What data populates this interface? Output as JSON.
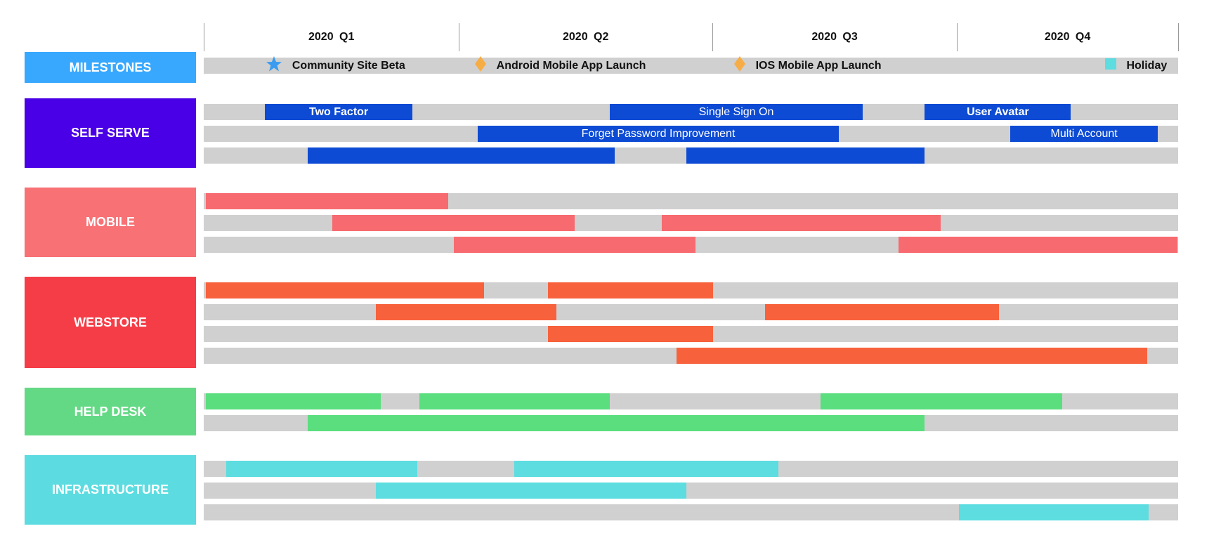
{
  "chart_data": {
    "type": "gantt",
    "title": "",
    "time_unit": "fraction of year 2020 (0 = start of Q1, 1 = end of Q4)",
    "xlim": [
      0,
      1
    ],
    "quarters": [
      {
        "label": "2020  Q1",
        "start": 0.0,
        "end": 0.262
      },
      {
        "label": "2020  Q2",
        "start": 0.262,
        "end": 0.522
      },
      {
        "label": "2020  Q3",
        "start": 0.522,
        "end": 0.773
      },
      {
        "label": "2020  Q4",
        "start": 0.773,
        "end": 1.0
      }
    ],
    "milestones": {
      "label": "MILESTONES",
      "color": "#38a8ff",
      "items": [
        {
          "label": "Community Site Beta",
          "at": 0.072,
          "marker": "star",
          "marker_color": "#3a9bf0"
        },
        {
          "label": "Android Mobile App Launch",
          "at": 0.286,
          "marker": "diamond",
          "marker_color": "#f7ad45"
        },
        {
          "label": "IOS Mobile App Launch",
          "at": 0.552,
          "marker": "diamond",
          "marker_color": "#f7ad45"
        },
        {
          "label": "Holiday",
          "at": 0.934,
          "marker": "square",
          "marker_color": "#5ddde0"
        }
      ]
    },
    "categories": [
      {
        "label": "SELF SERVE",
        "label_color": "#4a00e6",
        "bar_color": "#0d4bd4",
        "rows": [
          [
            {
              "label": "Two Factor",
              "start": 0.063,
              "end": 0.214,
              "bold": true
            },
            {
              "label": "Single Sign On",
              "start": 0.417,
              "end": 0.676,
              "bold": false
            },
            {
              "label": "User Avatar",
              "start": 0.74,
              "end": 0.89,
              "bold": true
            }
          ],
          [
            {
              "label": "Forget Password Improvement",
              "start": 0.281,
              "end": 0.652,
              "bold": false
            },
            {
              "label": "Multi Account",
              "start": 0.828,
              "end": 0.979,
              "bold": false
            }
          ],
          [
            {
              "label": "",
              "start": 0.107,
              "end": 0.422
            },
            {
              "label": "",
              "start": 0.495,
              "end": 0.74
            }
          ]
        ]
      },
      {
        "label": "MOBILE",
        "label_color": "#f77175",
        "bar_color": "#f76a6f",
        "rows": [
          [
            {
              "label": "",
              "start": 0.002,
              "end": 0.251
            }
          ],
          [
            {
              "label": "",
              "start": 0.132,
              "end": 0.381
            },
            {
              "label": "",
              "start": 0.47,
              "end": 0.756
            }
          ],
          [
            {
              "label": "",
              "start": 0.257,
              "end": 0.505
            },
            {
              "label": "",
              "start": 0.713,
              "end": 0.999
            }
          ]
        ]
      },
      {
        "label": "WEBSTORE",
        "label_color": "#f53d47",
        "bar_color": "#f7623d",
        "rows": [
          [
            {
              "label": "",
              "start": 0.002,
              "end": 0.288
            },
            {
              "label": "",
              "start": 0.353,
              "end": 0.523
            }
          ],
          [
            {
              "label": "",
              "start": 0.177,
              "end": 0.362
            },
            {
              "label": "",
              "start": 0.576,
              "end": 0.816
            }
          ],
          [
            {
              "label": "",
              "start": 0.353,
              "end": 0.523
            }
          ],
          [
            {
              "label": "",
              "start": 0.485,
              "end": 0.968
            }
          ]
        ]
      },
      {
        "label": "HELP DESK",
        "label_color": "#64d985",
        "bar_color": "#5ade7e",
        "rows": [
          [
            {
              "label": "",
              "start": 0.002,
              "end": 0.182
            },
            {
              "label": "",
              "start": 0.221,
              "end": 0.417
            },
            {
              "label": "",
              "start": 0.633,
              "end": 0.881
            }
          ],
          [
            {
              "label": "",
              "start": 0.107,
              "end": 0.74
            }
          ]
        ]
      },
      {
        "label": "INFRASTRUCTURE",
        "label_color": "#5cdce0",
        "bar_color": "#5ddde0",
        "rows": [
          [
            {
              "label": "",
              "start": 0.023,
              "end": 0.219
            },
            {
              "label": "",
              "start": 0.319,
              "end": 0.59
            }
          ],
          [
            {
              "label": "",
              "start": 0.177,
              "end": 0.495
            }
          ],
          [
            {
              "label": "",
              "start": 0.775,
              "end": 0.97
            }
          ]
        ]
      }
    ],
    "track_color": "#d0d0d0"
  }
}
